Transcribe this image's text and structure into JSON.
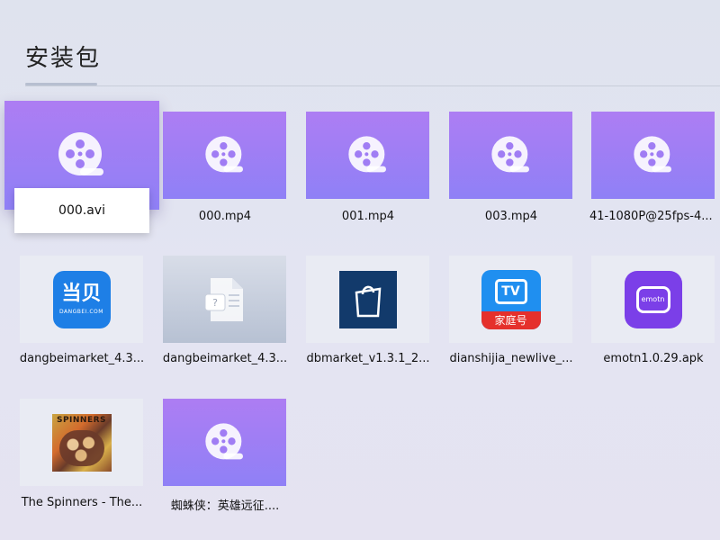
{
  "header": {
    "title": "安装包"
  },
  "row1": [
    {
      "name": "000.avi",
      "type": "video",
      "focused": true
    },
    {
      "name": "000.mp4",
      "type": "video"
    },
    {
      "name": "001.mp4",
      "type": "video"
    },
    {
      "name": "003.mp4",
      "type": "video"
    },
    {
      "name": "41-1080P@25fps-4...",
      "type": "video"
    }
  ],
  "row2": [
    {
      "name": "dangbeimarket_4.3...",
      "type": "apk",
      "icon": "dangbei-app-icon",
      "icon_text": "当贝",
      "icon_subtext": "DANGBEI.COM"
    },
    {
      "name": "dangbeimarket_4.3...",
      "type": "unknown-file",
      "icon": "unknown-file-icon"
    },
    {
      "name": "dbmarket_v1.3.1_2...",
      "type": "apk",
      "icon": "shopping-bag-app-icon"
    },
    {
      "name": "dianshijia_newlive_...",
      "type": "apk",
      "icon": "dianshijia-app-icon",
      "icon_text": "TV",
      "icon_subtext": "家庭号"
    },
    {
      "name": "emotn1.0.29.apk",
      "type": "apk",
      "icon": "emotn-app-icon",
      "icon_text": "emotn"
    }
  ],
  "row3": [
    {
      "name": "The Spinners - The...",
      "type": "audio",
      "icon": "album-cover-icon",
      "icon_text": "SPINNERS"
    },
    {
      "name": "蜘蛛侠：英雄远征....",
      "type": "video"
    }
  ],
  "colors": {
    "video_top": "#ad7df3",
    "video_bottom": "#8f80f6",
    "dangbei_blue": "#1e7fe6",
    "dianshijia_blue": "#1f8ff0",
    "dianshijia_red": "#e5302c",
    "emotn_purple": "#7b3fe8",
    "dbmarket_navy": "#123a6b"
  }
}
